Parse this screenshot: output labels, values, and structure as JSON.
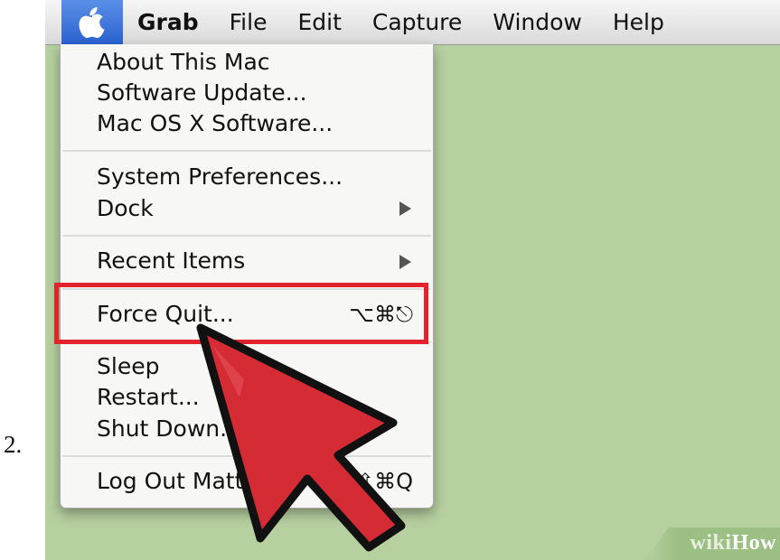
{
  "step": {
    "number": "2."
  },
  "menubar": {
    "apple_icon": "apple-logo-icon",
    "items": [
      {
        "label": "Grab",
        "bold": true
      },
      {
        "label": "File"
      },
      {
        "label": "Edit"
      },
      {
        "label": "Capture"
      },
      {
        "label": "Window"
      },
      {
        "label": "Help"
      }
    ]
  },
  "apple_menu": {
    "items": [
      {
        "label": "About This Mac"
      },
      {
        "label": "Software Update..."
      },
      {
        "label": "Mac OS X Software..."
      },
      {
        "label": "System Preferences..."
      },
      {
        "label": "Dock",
        "submenu": true
      },
      {
        "label": "Recent Items",
        "submenu": true
      },
      {
        "label": "Force Quit...",
        "shortcut": "⌥⌘⎋",
        "highlighted": true
      },
      {
        "label": "Sleep"
      },
      {
        "label": "Restart..."
      },
      {
        "label": "Shut Down..."
      },
      {
        "label": "Log Out Matt...",
        "shortcut": "⇧⌘Q"
      }
    ]
  },
  "annotation": {
    "highlight_color": "#e3232c",
    "pointer": "red-arrow-pointer-icon"
  },
  "watermark": {
    "wiki": "wiki",
    "how": "How"
  },
  "colors": {
    "desktop": "#b7d0a0",
    "selection_blue": "#3a6fd8",
    "annotation_red": "#e3232c"
  }
}
